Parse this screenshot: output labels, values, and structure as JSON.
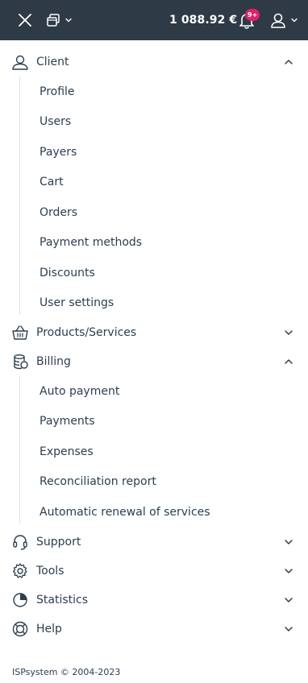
{
  "header": {
    "balance": "1 088.92 €",
    "notifications_badge": "9+"
  },
  "menu": {
    "client": {
      "label": "Client",
      "items": [
        "Profile",
        "Users",
        "Payers",
        "Cart",
        "Orders",
        "Payment methods",
        "Discounts",
        "User settings"
      ]
    },
    "products": {
      "label": "Products/Services"
    },
    "billing": {
      "label": "Billing",
      "items": [
        "Auto payment",
        "Payments",
        "Expenses",
        "Reconciliation report",
        "Automatic renewal of services"
      ]
    },
    "support": {
      "label": "Support"
    },
    "tools": {
      "label": "Tools"
    },
    "statistics": {
      "label": "Statistics"
    },
    "help": {
      "label": "Help"
    }
  },
  "footer": {
    "copyright": "ISPsystem © 2004-2023"
  },
  "colors": {
    "topbar": "#2e3a46",
    "badge": "#e0226b",
    "text": "#2c3e50"
  }
}
